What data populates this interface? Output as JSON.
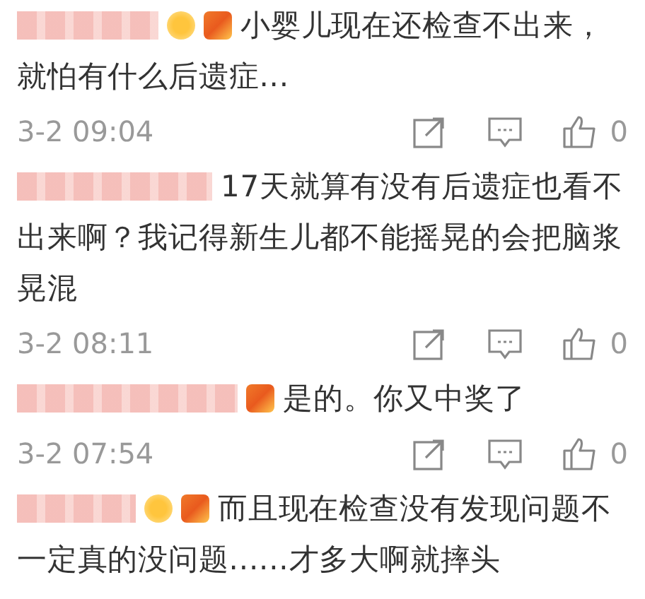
{
  "comments": [
    {
      "badges": [
        {
          "kind": "circle"
        },
        {
          "kind": "square"
        }
      ],
      "text": "小婴儿现在还检查不出来，就怕有什么后遗症...",
      "time": "3-2 09:04",
      "likes": "0"
    },
    {
      "text": "17天就算有没有后遗症也看不出来啊？我记得新生儿都不能摇晃的会把脑浆晃混",
      "time": "3-2 08:11",
      "likes": "0"
    },
    {
      "badges": [
        {
          "kind": "square"
        }
      ],
      "text": "是的。你又中奖了",
      "time": "3-2 07:54",
      "likes": "0"
    },
    {
      "badges": [
        {
          "kind": "circle"
        },
        {
          "kind": "square"
        }
      ],
      "text": "而且现在检查没有发现问题不一定真的没问题......才多大啊就摔头"
    }
  ]
}
